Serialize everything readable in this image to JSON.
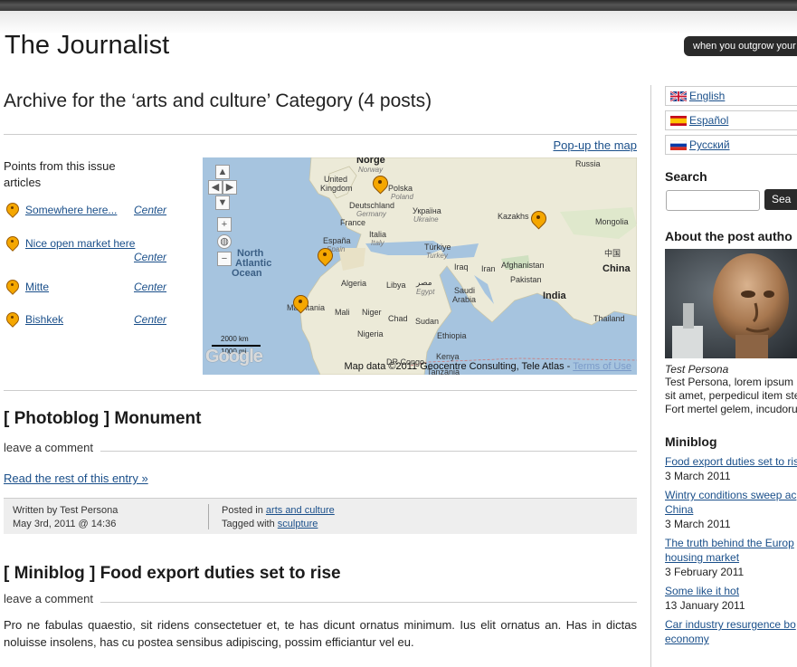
{
  "site": {
    "title": "The Journalist",
    "tagline": "when you outgrow your"
  },
  "archive": {
    "title": "Archive for the ‘arts and culture’ Category (4 posts)"
  },
  "map_widget": {
    "popup_link": "Pop-up the map",
    "points_title": "Points from this issue articles",
    "points": [
      {
        "name": "Somewhere here...",
        "center": "Center"
      },
      {
        "name": "Nice open market here",
        "center": "Center"
      },
      {
        "name": "Mitte",
        "center": "Center"
      },
      {
        "name": "Bishkek",
        "center": "Center"
      }
    ],
    "labels": {
      "russia": "Russia",
      "norge": "Norge",
      "norway": "Norway",
      "united": "United",
      "kingdom": "Kingdom",
      "polska": "Polska",
      "poland": "Poland",
      "deutschland": "Deutschland",
      "germany": "Germany",
      "ukraina_local": "Україна",
      "ukraine": "Ukraine",
      "kazakhstan": "Kazakhs",
      "mongolia": "Mongolia",
      "france": "France",
      "espana": "España",
      "spain": "Spain",
      "italia": "Italia",
      "italy": "Italy",
      "turkiye": "Türkiye",
      "turkey": "Turkey",
      "china_local": "中国",
      "china": "China",
      "north": "North",
      "atlantic": "Atlantic",
      "ocean": "Ocean",
      "iraq": "Iraq",
      "iran": "Iran",
      "afghanistan": "Afghanistan",
      "pakistan": "Pakistan",
      "algeria": "Algeria",
      "libya": "Libya",
      "egypt_local": "مصر",
      "egypt": "Egypt",
      "saudi": "Saudi",
      "arabia": "Arabia",
      "india": "India",
      "mauritania": "Mauritania",
      "mali": "Mali",
      "niger": "Niger",
      "chad": "Chad",
      "sudan": "Sudan",
      "thailand": "Thailand",
      "nigeria": "Nigeria",
      "ethiopia": "Ethiopia",
      "drcongo": "DR Congo",
      "kenya": "Kenya",
      "tanzania": "Tanzania"
    },
    "scale_km": "2000 km",
    "scale_mi": "1000 mi",
    "google": "Google",
    "map_data": "Map data ©2011 Geocentre Consulting, Tele Atlas - ",
    "terms": "Terms of Use"
  },
  "posts": [
    {
      "title": "[ Photoblog ] Monument",
      "comment": "leave a comment",
      "read_more": "Read the rest of this entry »",
      "written_by": "Written by Test Persona",
      "date": "May 3rd, 2011 @ 14:36",
      "posted_in_prefix": "Posted in ",
      "category": "arts and culture",
      "tagged_prefix": "Tagged with ",
      "tag": "sculpture"
    },
    {
      "title": "[ Miniblog ] Food export duties set to rise",
      "comment": "leave a comment",
      "excerpt": "Pro ne fabulas quaestio, sit ridens consectetuer et, te has dicunt ornatus minimum. Ius elit ornatus an. Has in dictas noluisse insolens, has cu postea sensibus adipiscing, possim efficiantur vel eu."
    }
  ],
  "sidebar": {
    "languages": [
      {
        "label": "English"
      },
      {
        "label": "Español"
      },
      {
        "label": "Русский"
      }
    ],
    "search_heading": "Search",
    "search_button": "Sea",
    "author_heading": "About the post autho",
    "author_name": "Test Persona",
    "author_bio": [
      "Test Persona, lorem ipsum",
      "sit amet, perpedicul item ste",
      "Fort mertel gelem, incudoru"
    ],
    "miniblog_heading": "Miniblog",
    "miniblog_items": [
      {
        "title": [
          "Food export duties set to ris"
        ],
        "date": "3 March 2011"
      },
      {
        "title": [
          "Wintry conditions sweep ac",
          "China"
        ],
        "date": "3 March 2011"
      },
      {
        "title": [
          "The truth behind the Europ",
          "housing market"
        ],
        "date": "3 February 2011"
      },
      {
        "title": [
          "Some like it hot"
        ],
        "date": "13 January 2011"
      },
      {
        "title": [
          "Car industry resurgence bo",
          "economy"
        ],
        "date": ""
      }
    ]
  }
}
